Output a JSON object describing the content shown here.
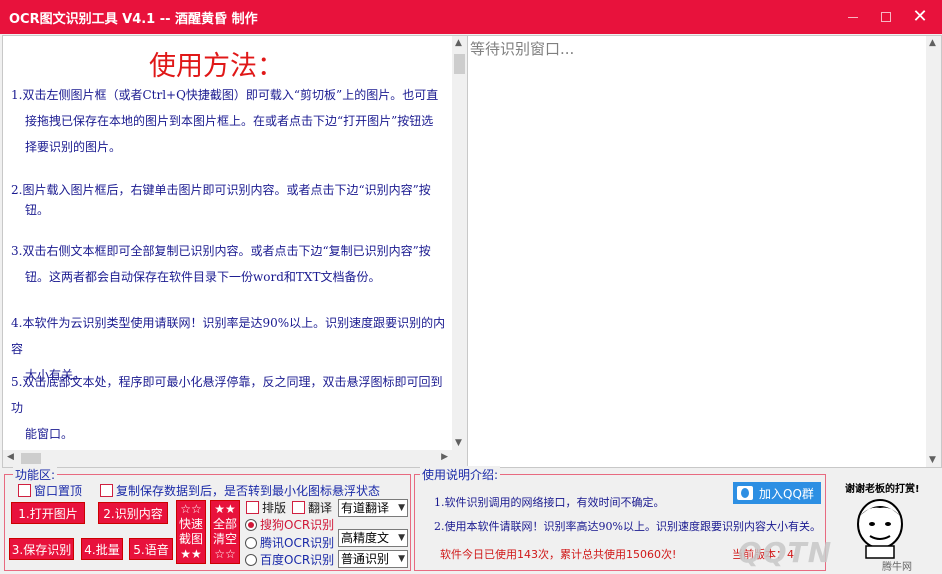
{
  "window": {
    "title": "OCR图文识别工具 V4.1 -- 酒醒黄昏 制作",
    "buttons": {
      "minimize": "minimize",
      "maximize": "maximize",
      "close": "✕"
    }
  },
  "instructions": {
    "title": "使用方法：",
    "steps": [
      {
        "line1": "1.双击左侧图片框（或者Ctrl+Q快捷截图）即可载入“剪切板”上的图片。也可直",
        "line2": "接拖拽已保存在本地的图片到本图片框上。在或者点击下边“打开图片”按钮选",
        "line3": "择要识别的图片。"
      },
      {
        "line1": "2.图片载入图片框后，右键单击图片即可识别内容。或者点击下边“识别内容”按",
        "line2": "钮。"
      },
      {
        "line1": "3.双击右侧文本框即可全部复制已识别内容。或者点击下边“复制已识别内容”按",
        "line2": "钮。这两者都会自动保存在软件目录下一份word和TXT文档备份。"
      },
      {
        "line1": "4.本软件为云识别类型使用请联网！识别率是达90%以上。识别速度跟要识别的内容",
        "line2": "大小有关。"
      },
      {
        "line1": "5.双击底部文本处，程序即可最小化悬浮停靠，反之同理，双击悬浮图标即可回到功",
        "line2": "能窗口。"
      }
    ]
  },
  "result_pane": {
    "placeholder": "等待识别窗口..."
  },
  "function_area": {
    "legend": "功能区:",
    "options": {
      "always_on_top": "窗口置顶",
      "copy_minimize": "复制保存数据到后，是否转到最小化图标悬浮状态",
      "layout": "排版",
      "translate": "翻译"
    },
    "buttons": {
      "open_image": "1.打开图片",
      "recognize": "2.识别内容",
      "save": "3.保存识别",
      "batch": "4.批量",
      "voice": "5.语音",
      "quick_capture": [
        "☆☆",
        "快速",
        "截图",
        "★★"
      ],
      "clear_all": [
        "★★",
        "全部",
        "清空",
        "☆☆"
      ]
    },
    "engines": [
      {
        "label": "搜狗OCR识别",
        "selected": true
      },
      {
        "label": "腾讯OCR识别",
        "selected": false
      },
      {
        "label": "百度OCR识别",
        "selected": false
      }
    ],
    "selects": {
      "translator": "有道翻译",
      "accuracy": "高精度文",
      "mode": "普通识别"
    }
  },
  "usage_info": {
    "legend": "使用说明介绍:",
    "line1": "1.软件识别调用的网络接口，有效时间不确定。",
    "line2": "2.使用本软件请联网！识别率高达90%以上。识别速度跟要识别内容大小有关。",
    "stats": "软件今日已使用143次，累计总共使用15060次!",
    "version_partial": "当前版本：4",
    "qq_button": "加入QQ群",
    "donate": "谢谢老板的打赏!"
  },
  "watermark": {
    "logo": "QQTN",
    "caption": "腾牛网"
  },
  "colors": {
    "titlebar": "#e8123c",
    "accent_red": "#e8123c",
    "link_blue": "#1a2aa8",
    "qq_blue": "#2d8fe3"
  }
}
